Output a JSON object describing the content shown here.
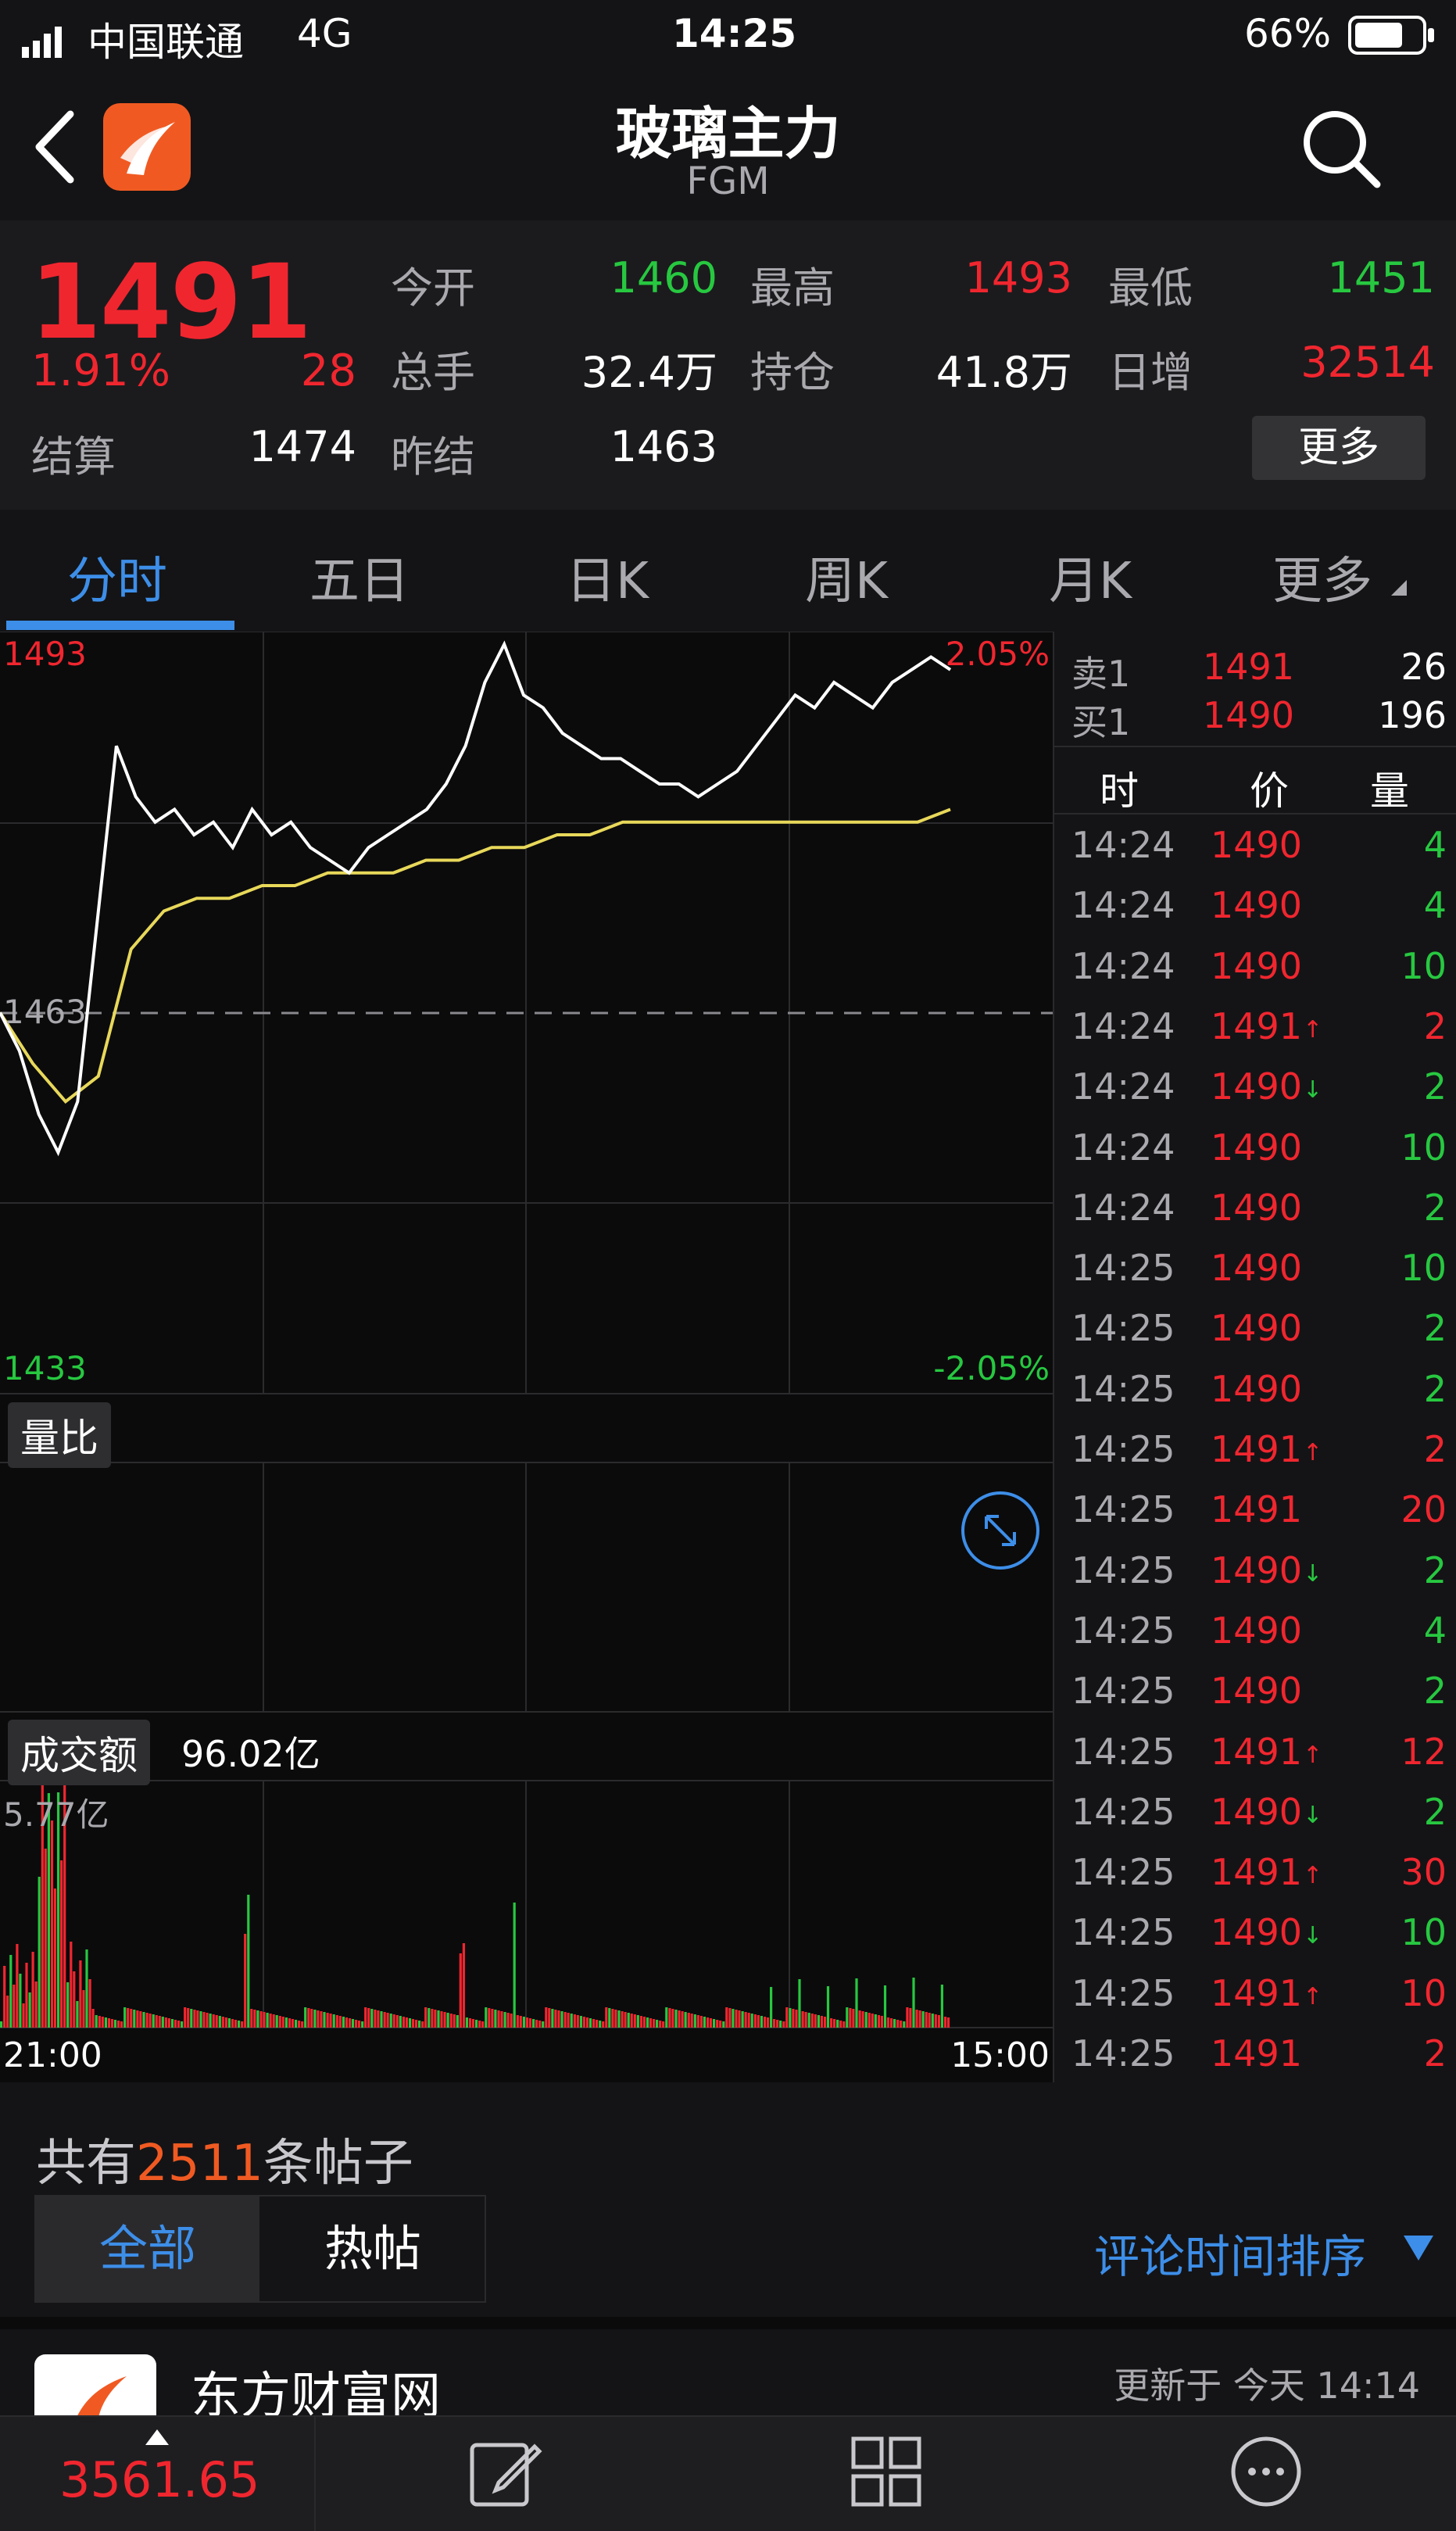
{
  "status_bar": {
    "carrier": "中国联通",
    "network": "4G",
    "time": "14:25",
    "battery": "66%"
  },
  "nav": {
    "title": "玻璃主力",
    "subtitle": "FGM",
    "back_icon": "chevron-left-icon",
    "search_icon": "search-icon"
  },
  "quote": {
    "price": "1491",
    "change_pct": "1.91%",
    "change": "28",
    "open_label": "今开",
    "open": "1460",
    "high_label": "最高",
    "high": "1493",
    "low_label": "最低",
    "low": "1451",
    "volume_label": "总手",
    "volume": "32.4万",
    "oi_label": "持仓",
    "oi": "41.8万",
    "daily_inc_label": "日增",
    "daily_inc": "32514",
    "settle_label": "结算",
    "settle": "1474",
    "prev_settle_label": "昨结",
    "prev_settle": "1463",
    "more_label": "更多"
  },
  "tabs": [
    {
      "label": "分时",
      "active": true
    },
    {
      "label": "五日"
    },
    {
      "label": "日K"
    },
    {
      "label": "周K"
    },
    {
      "label": "月K"
    },
    {
      "label": "更多"
    }
  ],
  "chart": {
    "top_price": "1493",
    "top_pct": "2.05%",
    "mid_price": "1463",
    "bottom_price": "1433",
    "bottom_pct": "-2.05%",
    "ratio_label": "量比",
    "turnover_label": "成交额",
    "turnover_value": "96.02亿",
    "turnover_max": "5.77亿",
    "time_start": "21:00",
    "time_end": "15:00"
  },
  "chart_data": {
    "type": "line",
    "ylim": [
      1433,
      1493
    ],
    "reference": 1463,
    "series": [
      {
        "values": [
          1463,
          1460,
          1455,
          1452,
          1456,
          1470,
          1484,
          1480,
          1478,
          1479,
          1477,
          1478,
          1476,
          1479,
          1477,
          1478,
          1476,
          1475,
          1474,
          1476,
          1477,
          1478,
          1479,
          1481,
          1484,
          1489,
          1492,
          1488,
          1487,
          1485,
          1484,
          1483,
          1483,
          1482,
          1481,
          1481,
          1480,
          1481,
          1482,
          1484,
          1486,
          1488,
          1487,
          1489,
          1488,
          1487,
          1489,
          1490,
          1491,
          1490
        ]
      },
      {
        "values": [
          1463,
          1459,
          1456,
          1458,
          1468,
          1471,
          1472,
          1472,
          1473,
          1473,
          1474,
          1474,
          1474,
          1475,
          1475,
          1476,
          1476,
          1477,
          1477,
          1478,
          1478,
          1478,
          1478,
          1478,
          1478,
          1478,
          1478,
          1478,
          1478,
          1479
        ]
      }
    ]
  },
  "order_book": [
    {
      "label": "卖1",
      "price": "1491",
      "qty": "26"
    },
    {
      "label": "买1",
      "price": "1490",
      "qty": "196"
    }
  ],
  "ticks_header": {
    "time": "时",
    "price": "价",
    "qty": "量"
  },
  "ticks": [
    {
      "time": "14:24",
      "price": "1490",
      "qty": "4",
      "dir": "",
      "qc": "green"
    },
    {
      "time": "14:24",
      "price": "1490",
      "qty": "4",
      "dir": "",
      "qc": "green"
    },
    {
      "time": "14:24",
      "price": "1490",
      "qty": "10",
      "dir": "",
      "qc": "green"
    },
    {
      "time": "14:24",
      "price": "1491",
      "qty": "2",
      "dir": "↑",
      "qc": "red"
    },
    {
      "time": "14:24",
      "price": "1490",
      "qty": "2",
      "dir": "↓",
      "qc": "green"
    },
    {
      "time": "14:24",
      "price": "1490",
      "qty": "10",
      "dir": "",
      "qc": "green"
    },
    {
      "time": "14:24",
      "price": "1490",
      "qty": "2",
      "dir": "",
      "qc": "green"
    },
    {
      "time": "14:25",
      "price": "1490",
      "qty": "10",
      "dir": "",
      "qc": "green"
    },
    {
      "time": "14:25",
      "price": "1490",
      "qty": "2",
      "dir": "",
      "qc": "green"
    },
    {
      "time": "14:25",
      "price": "1490",
      "qty": "2",
      "dir": "",
      "qc": "green"
    },
    {
      "time": "14:25",
      "price": "1491",
      "qty": "2",
      "dir": "↑",
      "qc": "red"
    },
    {
      "time": "14:25",
      "price": "1491",
      "qty": "20",
      "dir": "",
      "qc": "red"
    },
    {
      "time": "14:25",
      "price": "1490",
      "qty": "2",
      "dir": "↓",
      "qc": "green"
    },
    {
      "time": "14:25",
      "price": "1490",
      "qty": "4",
      "dir": "",
      "qc": "green"
    },
    {
      "time": "14:25",
      "price": "1490",
      "qty": "2",
      "dir": "",
      "qc": "green"
    },
    {
      "time": "14:25",
      "price": "1491",
      "qty": "12",
      "dir": "↑",
      "qc": "red"
    },
    {
      "time": "14:25",
      "price": "1490",
      "qty": "2",
      "dir": "↓",
      "qc": "green"
    },
    {
      "time": "14:25",
      "price": "1491",
      "qty": "30",
      "dir": "↑",
      "qc": "red"
    },
    {
      "time": "14:25",
      "price": "1490",
      "qty": "10",
      "dir": "↓",
      "qc": "green"
    },
    {
      "time": "14:25",
      "price": "1491",
      "qty": "10",
      "dir": "↑",
      "qc": "red"
    },
    {
      "time": "14:25",
      "price": "1491",
      "qty": "2",
      "dir": "",
      "qc": "red"
    }
  ],
  "posts": {
    "count_prefix": "共有",
    "count": "2511",
    "count_suffix": "条帖子",
    "tab_all": "全部",
    "tab_hot": "热帖",
    "sort_label": "评论时间排序",
    "source_name": "东方财富网",
    "updated": "更新于 今天 14:14"
  },
  "bottom": {
    "index_value": "3561.65"
  },
  "colors": {
    "up": "#f0262f",
    "down": "#27c840",
    "accent": "#3d8ee8",
    "avg_line": "#e8d85a",
    "brand": "#f05a22"
  }
}
